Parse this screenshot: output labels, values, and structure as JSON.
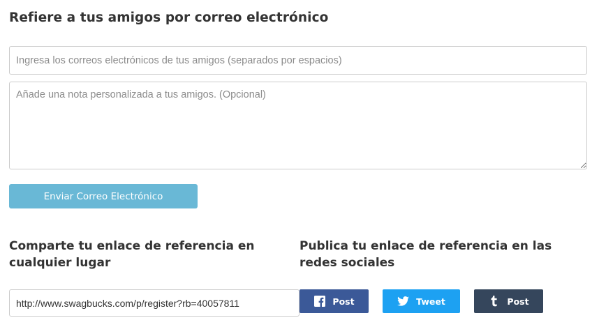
{
  "email_section": {
    "title": "Refiere a tus amigos por correo electrónico",
    "emails_placeholder": "Ingresa los correos electrónicos de tus amigos (separados por espacios)",
    "emails_value": "",
    "note_placeholder": "Añade una nota personalizada a tus amigos. (Opcional)",
    "note_value": "",
    "send_label": "Enviar Correo Electrónico"
  },
  "share_section": {
    "title": "Comparte tu enlace de referencia en cualquier lugar",
    "link_value": "http://www.swagbucks.com/p/register?rb=40057811"
  },
  "social_section": {
    "title": "Publica tu enlace de referencia en las redes sociales",
    "buttons": [
      {
        "label": "Post",
        "icon": "facebook-icon",
        "color": "#3b5998"
      },
      {
        "label": "Tweet",
        "icon": "twitter-icon",
        "color": "#1da1f2"
      },
      {
        "label": "Post",
        "icon": "tumblr-icon",
        "color": "#35465c"
      }
    ]
  },
  "colors": {
    "send_button": "#69b8d6",
    "heading_text": "#333333",
    "input_border": "#cccccc"
  }
}
